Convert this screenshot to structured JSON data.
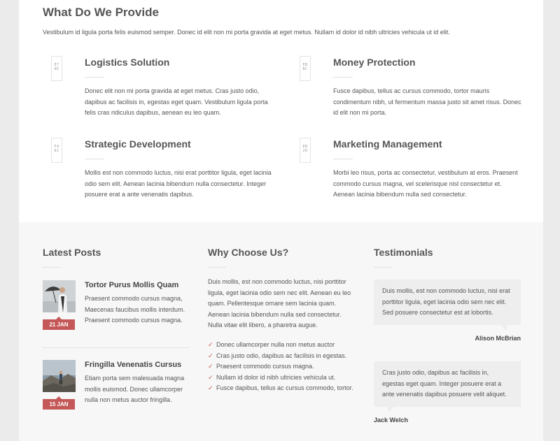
{
  "provide": {
    "title": "What Do We Provide",
    "intro": "Vestibulum id ligula porta felis euismod semper. Donec id elit non mi porta gravida at eget metus. Nullam id dolor id nibh ultricies vehicula ut id elit.",
    "services": [
      {
        "icon": "logistics-icon",
        "glyph": "E7 9E",
        "title": "Logistics Solution",
        "text": "Donec elit non mi porta gravida at eget metus. Cras justo odio, dapibus ac facilisis in, egestas eget quam. Vestibulum ligula porta felis cras ridiculus dapibus, aenean eu leo quam."
      },
      {
        "icon": "money-protection-icon",
        "glyph": "EB BC",
        "title": "Money Protection",
        "text": "Fusce dapibus, tellus ac cursus commodo, tortor mauris condimentum nibh, ut fermentum massa justo sit amet risus. Donec id elit non mi porta."
      },
      {
        "icon": "strategy-icon",
        "glyph": "F4 81",
        "title": "Strategic Development",
        "text": "Mollis est non commodo luctus, nisi erat porttitor ligula, eget lacinia odio sem elit. Aenean lacinia bibendum nulla consectetur. Integer posuere erat a ante venenatis dapibus."
      },
      {
        "icon": "marketing-icon",
        "glyph": "EB 2D",
        "title": "Marketing Management",
        "text": "Morbi leo risus, porta ac consectetur, vestibulum at eros. Praesent commodo cursus magna, vel scelerisque nisl consectetur et. Aenean lacinia bibendum nulla sed consectetur."
      }
    ]
  },
  "latest_posts": {
    "title": "Latest Posts",
    "posts": [
      {
        "title": "Tortor Purus Mollis Quam",
        "text": "Praesent commodo cursus magna, Maecenas faucibus mollis interdum. Praesent commodo cursus magna.",
        "date": "21 JAN"
      },
      {
        "title": "Fringilla Venenatis Cursus",
        "text": "Etiam porta sem malesuada magna mollis euismod. Donec ullamcorper nulla non metus auctor fringilla.",
        "date": "15 JAN"
      }
    ]
  },
  "why_choose": {
    "title": "Why Choose Us?",
    "text": "Duis mollis, est non commodo luctus, nisi porttitor ligula, eget lacinia odio sem nec elit. Aenean eu leo quam. Pellentesque ornare sem lacinia quam. Aenean lacinia bibendum nulla sed consectetur. Nulla vitae elit libero, a pharetra augue.",
    "items": [
      "Donec ullamcorper nulla non metus auctor",
      "Cras justo odio, dapibus ac facilisis in egestas.",
      "Praesent commodo cursus magna.",
      "Nullam id dolor id nibh ultricies vehicula ut.",
      "Fusce dapibus, tellus ac cursus commodo, tortor."
    ],
    "check_icon": "checkmark-icon",
    "accent": "#c45858"
  },
  "testimonials": {
    "title": "Testimonials",
    "items": [
      {
        "quote": "Duis mollis, est non commodo luctus, nisi erat porttitor ligula, eget lacinia odio sem nec elit. Sed posuere consectetur est at lobortis.",
        "name": "Alison McBrian"
      },
      {
        "quote": "Cras justo odio, dapibus ac facilisis in, egestas eget quam. Integer posuere erat a ante venenatis dapibus posuere velit aliquet.",
        "name": "Jack Welch"
      }
    ]
  },
  "colors": {
    "accent": "#c45858",
    "page_background": "#ffffff",
    "lower_background": "#f7f7f7",
    "outer_background": "#ebebeb"
  }
}
